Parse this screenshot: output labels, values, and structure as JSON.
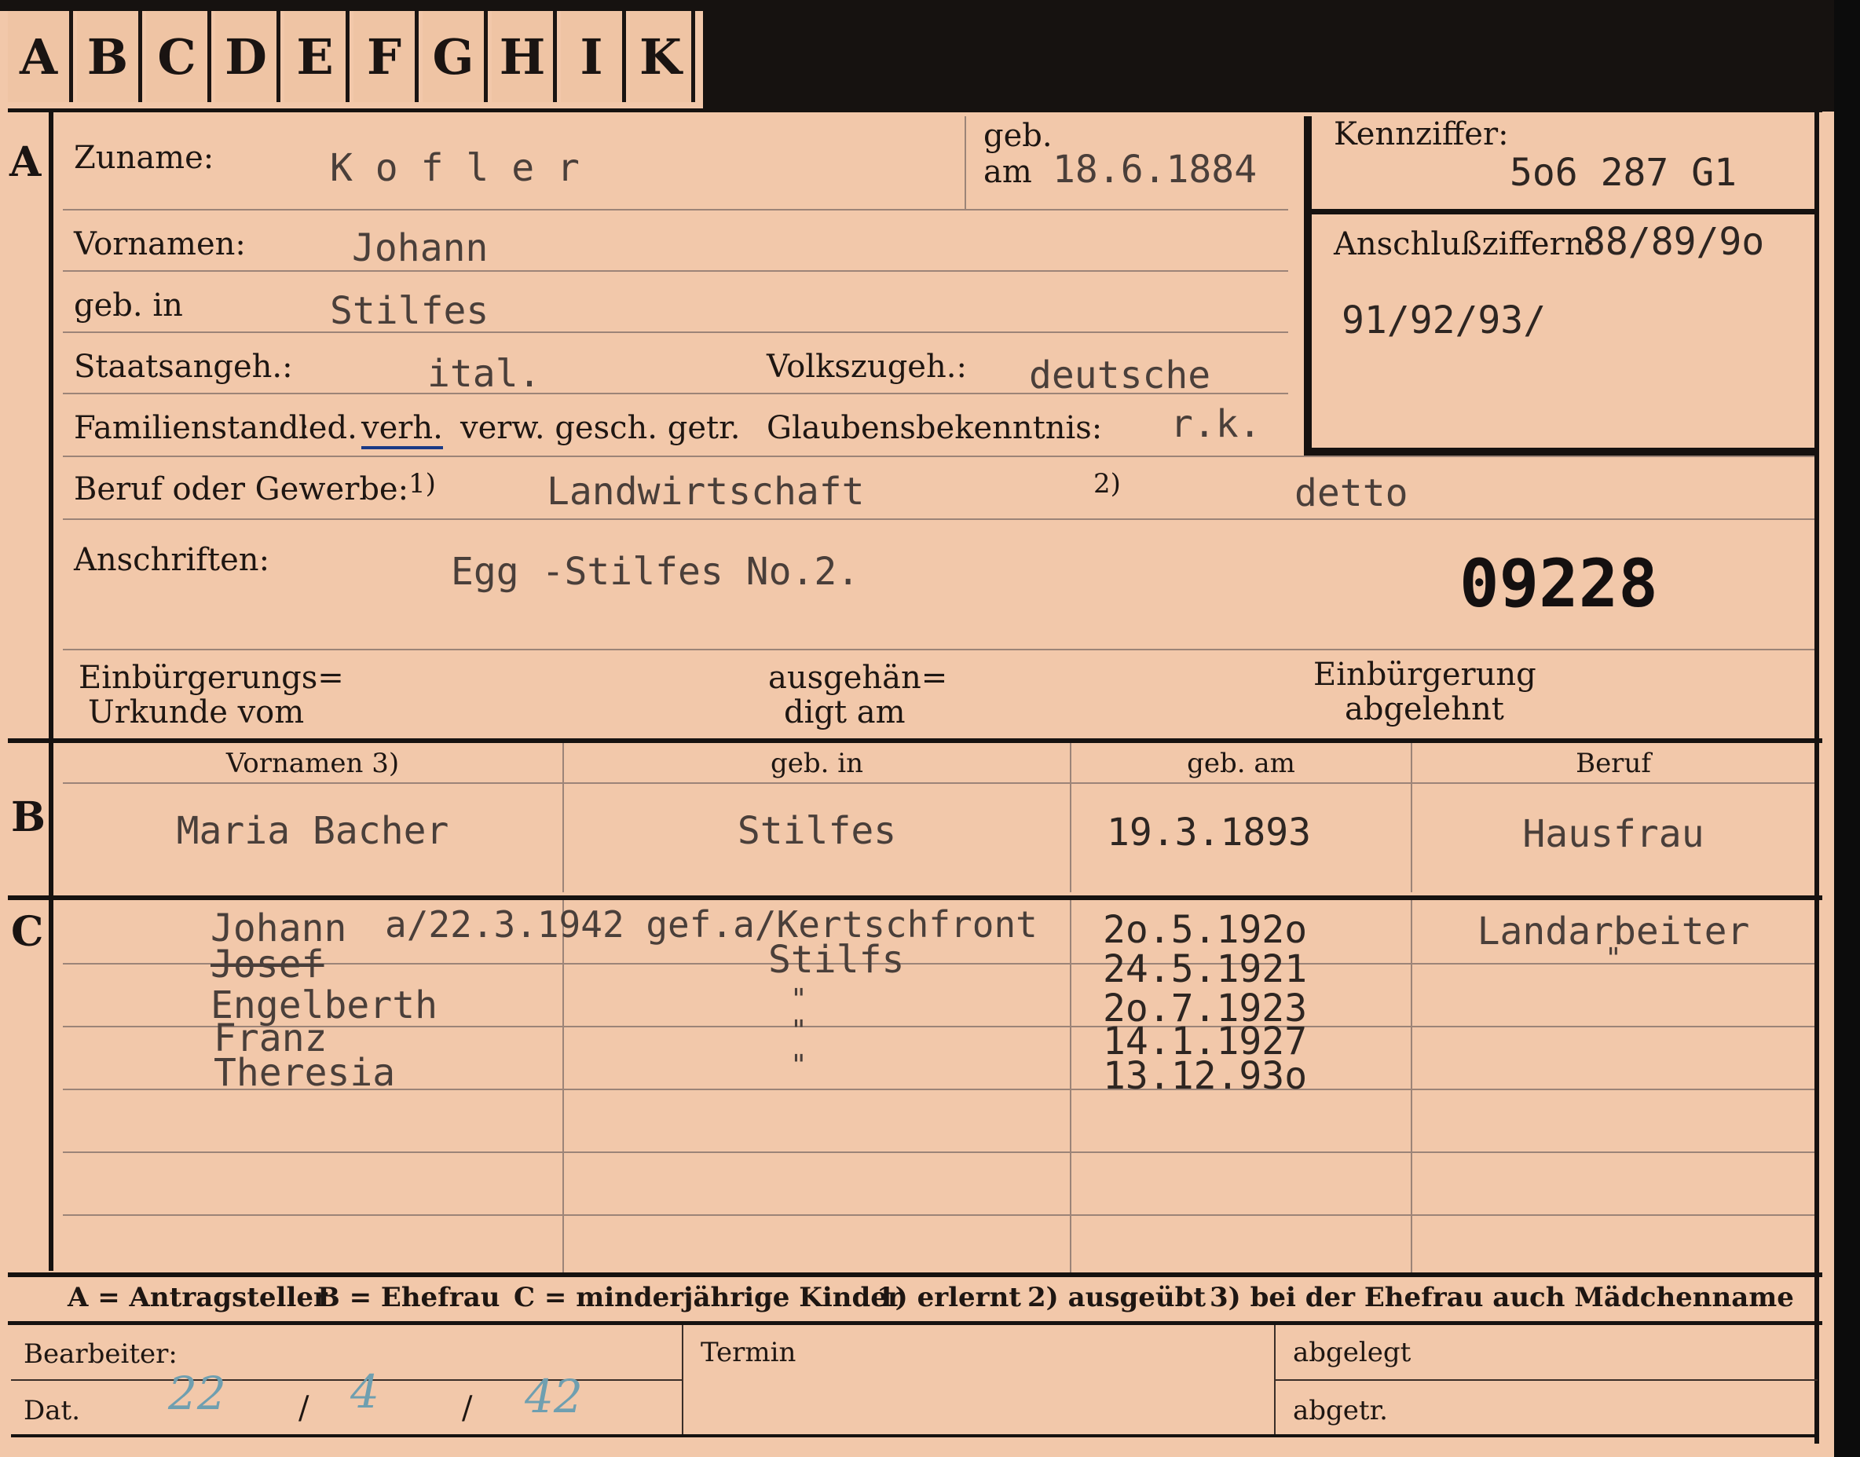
{
  "tabs": [
    "A",
    "B",
    "C",
    "D",
    "E",
    "F",
    "G",
    "H",
    "I",
    "K"
  ],
  "sections": {
    "a": "A",
    "b": "B",
    "c": "C"
  },
  "applicant": {
    "surname_label": "Zuname:",
    "surname": "K o f l e r",
    "born_label_top": "geb.",
    "born_label_bottom": "am",
    "born_date": "18.6.1884",
    "firstnames_label": "Vornamen:",
    "firstnames": "Johann",
    "birthplace_label": "geb. in",
    "birthplace": "Stilfes",
    "citizenship_label": "Staatsangeh.:",
    "citizenship": "ital.",
    "ethnicity_label": "Volkszugeh.:",
    "ethnicity": "deutsche",
    "marital_label": "Familienstand:",
    "marital_led": "led.",
    "marital_verh": "verh.",
    "marital_rest": "verw. gesch. getr.",
    "religion_label": "Glaubensbekenntnis:",
    "religion": "r.k.",
    "occupation_label": "Beruf oder Gewerbe:",
    "note1_mark": "1)",
    "occupation_learned": "Landwirtschaft",
    "note2_mark": "2)",
    "occupation_practiced": "detto",
    "address_label": "Anschriften:",
    "address": "Egg -Stilfes No.2.",
    "stamp_number": "09228",
    "naturalization_doc_label_1": "Einbürgerungs=",
    "naturalization_doc_label_2": "Urkunde vom",
    "handed_out_label_1": "ausgehän=",
    "handed_out_label_2": "digt am",
    "naturalization_refused_label_1": "Einbürgerung",
    "naturalization_refused_label_2": "abgelehnt"
  },
  "reference": {
    "code_label": "Kennziffer:",
    "code": "5o6 287   G1",
    "connection_label": "Anschlußziffern:",
    "connection_line1": "88/89/9o",
    "connection_line2": "91/92/93/"
  },
  "spouse": {
    "headers": [
      "Vornamen 3)",
      "geb. in",
      "geb. am",
      "Beruf"
    ],
    "name": "Maria Bacher",
    "birthplace": "Stilfes",
    "birthdate": "19.3.1893",
    "occupation": "Hausfrau"
  },
  "children": [
    {
      "name": "Johann",
      "note": "a/22.3.1942 gef.a/Kertschfront",
      "birthplace": "",
      "birthdate": "2o.5.192o",
      "occupation": "Landarbeiter"
    },
    {
      "name": "Josef",
      "note": "",
      "birthplace": "Stilfs",
      "birthdate": "24.5.1921",
      "occupation": "\""
    },
    {
      "name": "Engelberth",
      "note": "",
      "birthplace": "\"",
      "birthdate": "2o.7.1923",
      "occupation": ""
    },
    {
      "name": "Franz",
      "note": "",
      "birthplace": "\"",
      "birthdate": "14.1.1927",
      "occupation": ""
    },
    {
      "name": "Theresia",
      "note": "",
      "birthplace": "\"",
      "birthdate": "13.12.93o",
      "occupation": ""
    }
  ],
  "legend": {
    "a": "A = Antragsteller",
    "b": "B = Ehefrau",
    "c": "C = minderjährige Kinder",
    "n1": "1) erlernt",
    "n2": "2) ausgeübt",
    "n3": "3) bei der Ehefrau auch Mädchenname"
  },
  "footer": {
    "clerk_label": "Bearbeiter:",
    "date_label": "Dat.",
    "date_handwritten": [
      "22",
      "4",
      "42"
    ],
    "date_separators": [
      "/",
      "/"
    ],
    "deadline_label": "Termin",
    "filed_label": "abgelegt",
    "dispatched_label": "abgetr."
  }
}
